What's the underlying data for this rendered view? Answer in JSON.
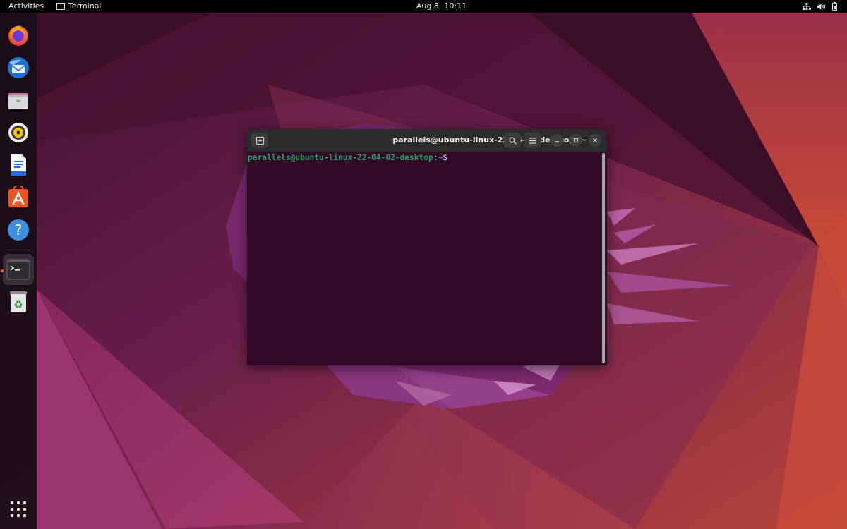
{
  "topbar": {
    "activities": "Activities",
    "app_name": "Terminal",
    "date": "Aug 8",
    "time": "10:11",
    "tray_icons": [
      "network-icon",
      "volume-icon",
      "battery-icon"
    ]
  },
  "dock": {
    "apps": [
      {
        "name": "Firefox",
        "icon": "firefox-icon"
      },
      {
        "name": "Thunderbird",
        "icon": "thunderbird-icon"
      },
      {
        "name": "Files",
        "icon": "files-icon"
      },
      {
        "name": "Rhythmbox",
        "icon": "rhythmbox-icon"
      },
      {
        "name": "LibreOffice Writer",
        "icon": "writer-icon"
      },
      {
        "name": "Ubuntu Software",
        "icon": "software-icon"
      },
      {
        "name": "Help",
        "icon": "help-icon"
      },
      {
        "name": "Terminal",
        "icon": "terminal-icon",
        "running": true
      },
      {
        "name": "Trash",
        "icon": "trash-icon"
      }
    ],
    "show_apps_icon": "app-grid-icon"
  },
  "terminal": {
    "title": "parallels@ubuntu-linux-22-04-02-desktop: ~",
    "prompt_user_host": "parallels@ubuntu-linux-22-04-02-desktop",
    "prompt_sep": ":",
    "prompt_path": "~",
    "prompt_symbol": "$",
    "buttons": [
      "new-tab-icon",
      "search-icon",
      "hamburger-menu-icon",
      "minimize-icon",
      "maximize-icon",
      "close-icon"
    ]
  },
  "colors": {
    "terminal_bg": "#300a24",
    "prompt_user": "#26a269",
    "prompt_path": "#3b6fc8",
    "titlebar": "#2b2b2b",
    "topbar": "#000000",
    "accent": "#e95420"
  }
}
